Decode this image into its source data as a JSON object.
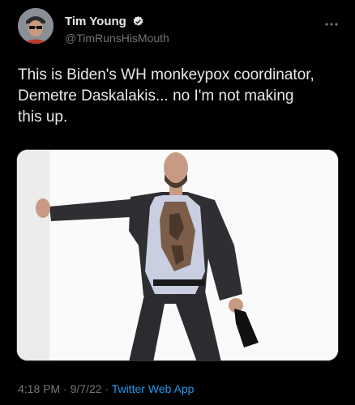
{
  "author": {
    "display_name": "Tim Young",
    "handle": "@TimRunsHisMouth",
    "verified": true
  },
  "tweet": {
    "text": "This is Biden's WH monkeypox coordinator,\nDemetre Daskalakis... no I'm not making\nthis up."
  },
  "meta": {
    "time": "4:18 PM",
    "separator": "·",
    "date": "9/7/22",
    "app": "Twitter Web App"
  },
  "icons": {
    "verified": "verified-badge-icon",
    "more": "more-dots-icon"
  },
  "colors": {
    "background": "#000000",
    "text": "#e7e9ea",
    "secondary": "#71767b",
    "link": "#1d9bf0"
  }
}
